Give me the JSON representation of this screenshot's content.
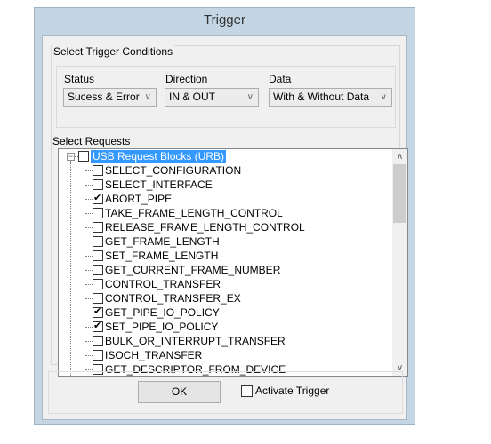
{
  "window": {
    "title": "Trigger"
  },
  "conditions": {
    "group_label": "Select Trigger Conditions",
    "status": {
      "label": "Status",
      "value": "Sucess & Error"
    },
    "direction": {
      "label": "Direction",
      "value": "IN & OUT"
    },
    "data": {
      "label": "Data",
      "value": "With & Without Data"
    }
  },
  "requests": {
    "label": "Select Requests",
    "root": {
      "label": "USB Request Blocks (URB)",
      "checked": false,
      "expanded": true,
      "selected": true
    },
    "items": [
      {
        "label": "SELECT_CONFIGURATION",
        "checked": false
      },
      {
        "label": "SELECT_INTERFACE",
        "checked": false
      },
      {
        "label": "ABORT_PIPE",
        "checked": true
      },
      {
        "label": "TAKE_FRAME_LENGTH_CONTROL",
        "checked": false
      },
      {
        "label": "RELEASE_FRAME_LENGTH_CONTROL",
        "checked": false
      },
      {
        "label": "GET_FRAME_LENGTH",
        "checked": false
      },
      {
        "label": "SET_FRAME_LENGTH",
        "checked": false
      },
      {
        "label": "GET_CURRENT_FRAME_NUMBER",
        "checked": false
      },
      {
        "label": "CONTROL_TRANSFER",
        "checked": false
      },
      {
        "label": "CONTROL_TRANSFER_EX",
        "checked": false
      },
      {
        "label": "GET_PIPE_IO_POLICY",
        "checked": true
      },
      {
        "label": "SET_PIPE_IO_POLICY",
        "checked": true
      },
      {
        "label": "BULK_OR_INTERRUPT_TRANSFER",
        "checked": false
      },
      {
        "label": "ISOCH_TRANSFER",
        "checked": false
      },
      {
        "label": "GET_DESCRIPTOR_FROM_DEVICE",
        "checked": false
      }
    ]
  },
  "footer": {
    "ok_label": "OK",
    "activate_label": "Activate Trigger",
    "activate_checked": false
  },
  "icons": {
    "chevron_down": "∨",
    "chevron_up": "∧",
    "collapse": "−"
  }
}
